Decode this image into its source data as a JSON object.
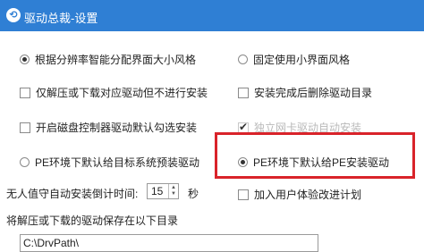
{
  "window": {
    "title": "驱动总裁-设置",
    "logo_glyph": "⟲"
  },
  "options": {
    "radio_auto_size": "根据分辨率智能分配界面大小风格",
    "radio_fixed_small": "固定使用小界面风格",
    "chk_unpack_only": "仅解压或下载对应驱动但不进行安装",
    "chk_delete_after": "安装完成后删除驱动目录",
    "chk_disk_controller": "开启磁盘控制器驱动默认勾选安装",
    "chk_disabled_item": "独立网卡驱动自动安装",
    "radio_pe_target": "PE环境下默认给目标系统预装驱动",
    "radio_pe_self": "PE环境下默认给PE安装驱动",
    "chk_user_exp": "加入用户体验改进计划"
  },
  "countdown": {
    "label": "无人值守自动安装倒计时间:",
    "value": "15",
    "unit": "秒"
  },
  "save_path": {
    "label": "将解压或下载的驱动保存在以下目录",
    "value": "C:\\DrvPath\\"
  },
  "colors": {
    "titlebar": "#2f7fd4",
    "highlight": "#d9232a"
  }
}
